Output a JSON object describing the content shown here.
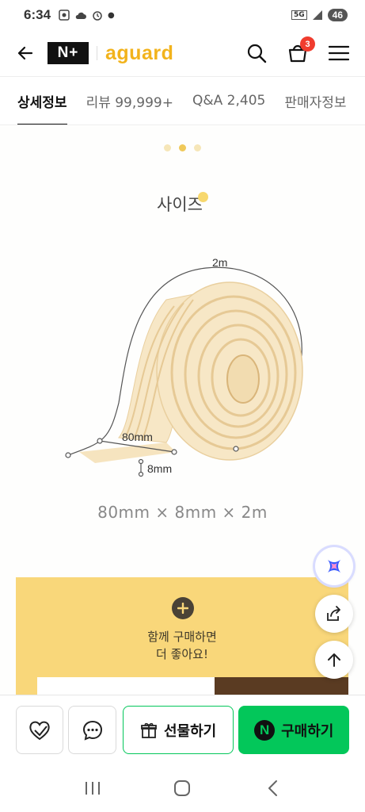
{
  "status_bar": {
    "time": "6:34",
    "network": "5G",
    "battery": "46"
  },
  "header": {
    "np_logo": "N+",
    "brand": "aguard",
    "cart_count": "3",
    "icons": [
      "back-arrow-icon",
      "search-icon",
      "cart-icon",
      "menu-icon"
    ]
  },
  "tabs": [
    {
      "label": "상세정보",
      "active": true
    },
    {
      "label": "리뷰 99,999+",
      "active": false
    },
    {
      "label": "Q&A 2,405",
      "active": false
    },
    {
      "label": "판매자정보",
      "active": false
    }
  ],
  "detail": {
    "section_title": "사이즈",
    "dim_length": "2m",
    "dim_width": "80mm",
    "dim_thickness": "8mm",
    "size_caption": "80mm × 8mm × 2m",
    "bundle_text_line1": "함께 구매하면",
    "bundle_text_line2": "더 좋아요!"
  },
  "bottom_bar": {
    "gift_label": "선물하기",
    "buy_label": "구매하기",
    "buy_badge": "N"
  },
  "colors": {
    "brand": "#f2b31c",
    "cart_badge": "#f03c2e",
    "buy_green": "#03c75a",
    "bundle_bg": "#f9d77a",
    "roll": "#f7e7c6"
  }
}
